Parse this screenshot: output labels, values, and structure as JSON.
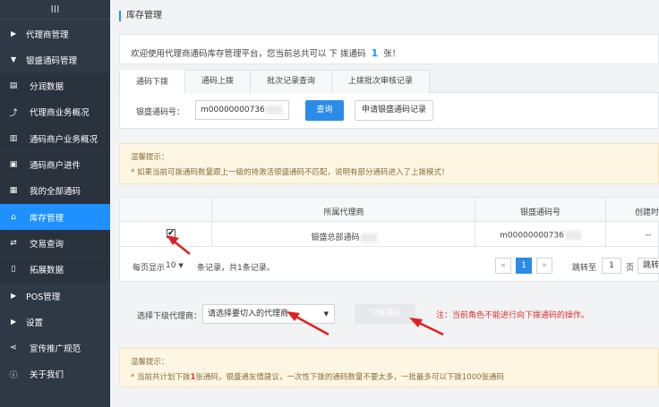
{
  "sidebar": {
    "top_icon": "III",
    "items": [
      {
        "label": "代理商管理",
        "icon": "caret-right-icon",
        "kind": "group"
      },
      {
        "label": "银盛通码管理",
        "icon": "caret-down-icon",
        "kind": "group"
      },
      {
        "label": "分润数据",
        "icon": "money-icon",
        "kind": "sub"
      },
      {
        "label": "代理商业务概况",
        "icon": "chart-icon",
        "kind": "sub"
      },
      {
        "label": "通码商户业务概况",
        "icon": "bar-chart-icon",
        "kind": "sub"
      },
      {
        "label": "通码商户进件",
        "icon": "cart-icon",
        "kind": "sub"
      },
      {
        "label": "我的全部通码",
        "icon": "qrcode-icon",
        "kind": "sub"
      },
      {
        "label": "库存管理",
        "icon": "bank-icon",
        "kind": "sub",
        "active": true
      },
      {
        "label": "交易查询",
        "icon": "exchange-icon",
        "kind": "sub"
      },
      {
        "label": "拓展数据",
        "icon": "file-icon",
        "kind": "sub"
      },
      {
        "label": "POS管理",
        "icon": "caret-right-icon",
        "kind": "group"
      },
      {
        "label": "设置",
        "icon": "caret-right-icon",
        "kind": "group"
      },
      {
        "label": "宣传推广规范",
        "icon": "share-icon",
        "kind": "plain"
      },
      {
        "label": "关于我们",
        "icon": "info-icon",
        "kind": "plain"
      }
    ]
  },
  "page": {
    "title": "库存管理",
    "welcome_prefix": "欢迎使用代理商通码库存管理平台，您当前总共可以 下 拨通码",
    "welcome_count": "1",
    "welcome_suffix": "张！"
  },
  "tabs": [
    "通码下拨",
    "通码上拨",
    "批次记录查询",
    "上拨批次审核记录"
  ],
  "search": {
    "label": "银盛通码号：",
    "value": "m00000000736",
    "query_button": "查询",
    "apply_button": "申请银盛通码记录"
  },
  "tip1": {
    "title": "温馨提示：",
    "body": "* 如果当前可拨通码数量跟上一级的待激活银盛通码不匹配，说明有部分通码进入了上拨模式！"
  },
  "table": {
    "headers": [
      "所属代理商",
      "银盛通码号",
      "创建时间"
    ],
    "rows": [
      {
        "checked": true,
        "agent": "银盛总部通码",
        "code": "m00000000736",
        "created": "--"
      }
    ]
  },
  "pager": {
    "per_page_label": "每页显示",
    "per_page_value": "10",
    "summary": "条记录，共1条记录。",
    "prev": "«",
    "current": "1",
    "next": "»",
    "jump_label": "跳转至",
    "jump_value": "1",
    "page_unit": "页",
    "jump_button": "跳转"
  },
  "assign": {
    "label": "选择下级代理商：",
    "select_value": "请选择要切入的代理商",
    "button": "下拨通码",
    "note": "注：当前角色不能进行向下拨通码的操作。"
  },
  "tip2": {
    "title": "温馨提示：",
    "body_prefix": "* 当前共计划下拨",
    "body_count": "1",
    "body_suffix": "张通码，银盛通友情建议，一次性下拨的通码数量不要太多，一批最多可以下拨1000张通码"
  },
  "colors": {
    "accent": "#1e90ff",
    "sidebar_bg": "#2f3845",
    "warn": "#e03030"
  }
}
